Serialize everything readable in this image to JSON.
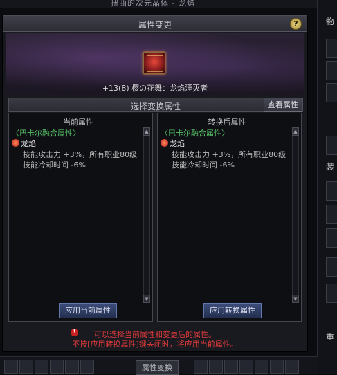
{
  "window": {
    "title": "扭曲的次元晶体 - 龙焰"
  },
  "dialog": {
    "title": "属性变更",
    "help_label": "?",
    "item_name": "+13(8) 樱の花舞：龙焰湮灭者",
    "section_title": "选择变换属性",
    "view_button": "查看属性",
    "current": {
      "title": "当前属性",
      "fusion": "〈巴卡尔融合属性〉",
      "attr_name": "龙焰",
      "lines": [
        "技能攻击力 +3%，所有职业80级",
        "技能冷却时间 -6%"
      ],
      "apply_button": "应用当前属性"
    },
    "converted": {
      "title": "转换后属性",
      "fusion": "〈巴卡尔融合属性〉",
      "attr_name": "龙焰",
      "lines": [
        "技能攻击力 +3%，所有职业80级",
        "技能冷却时间 -6%"
      ],
      "apply_button": "应用转换属性"
    },
    "notice_lines": [
      "可以选择当前属性和变更后的属性。",
      "不按[应用转换属性]键关闭时，将应用当前属性。"
    ]
  },
  "side_panel": {
    "tab1": "物",
    "tab2": "装",
    "tab3": "重"
  },
  "bottom": {
    "tab_label": "属性变换"
  },
  "colors": {
    "fusion_green": "#58c46a",
    "notice_red": "#e23b3b",
    "button_blue": "#3c4c7a"
  },
  "icons": [
    "help-icon",
    "item-icon",
    "fire-icon",
    "warning-icon",
    "scroll-up-icon",
    "scroll-down-icon"
  ]
}
